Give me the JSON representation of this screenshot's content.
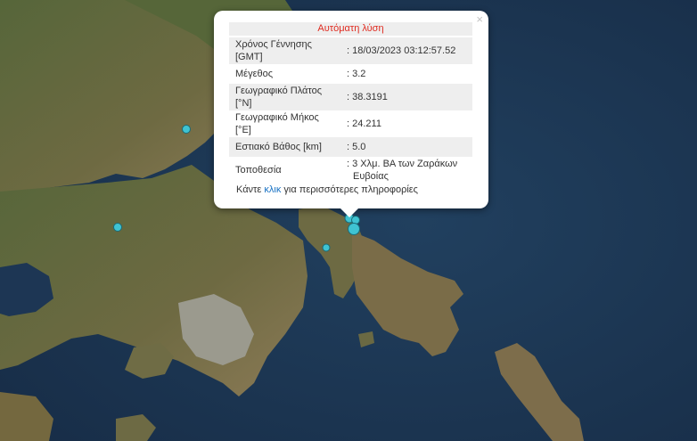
{
  "popup": {
    "title": "Αυτόματη λύση",
    "close_symbol": "×",
    "rows": [
      {
        "label_line1": "Χρόνος Γέννησης",
        "label_line2": "[GMT]",
        "value_line1": ": 18/03/2023 03:12:57.52",
        "value_line2": ""
      },
      {
        "label_line1": "Μέγεθος",
        "label_line2": "",
        "value_line1": ": 3.2",
        "value_line2": ""
      },
      {
        "label_line1": "Γεωγραφικό Πλάτος",
        "label_line2": "[°N]",
        "value_line1": ": 38.3191",
        "value_line2": ""
      },
      {
        "label_line1": "Γεωγραφικό Μήκος",
        "label_line2": "[°E]",
        "value_line1": ": 24.211",
        "value_line2": ""
      },
      {
        "label_line1": "Εστιακό Βάθος [km]",
        "label_line2": "",
        "value_line1": ": 5.0",
        "value_line2": ""
      },
      {
        "label_line1": "Τοποθεσία",
        "label_line2": "",
        "value_line1": ": 3 Χλμ. ΒΑ των Ζαράκων",
        "value_line2": "Ευβοίας"
      }
    ],
    "note_prefix": "Κάντε ",
    "note_link": "κλικ",
    "note_suffix": " για περισσότερες πληροφορίες"
  },
  "colors": {
    "sea": "#1b3350",
    "land": "#5f6a3d",
    "land_light": "#8a7a55",
    "urban": "#9a9a90",
    "marker": "#3fc3d2",
    "title_red": "#e02b20",
    "link": "#1a73c4"
  }
}
